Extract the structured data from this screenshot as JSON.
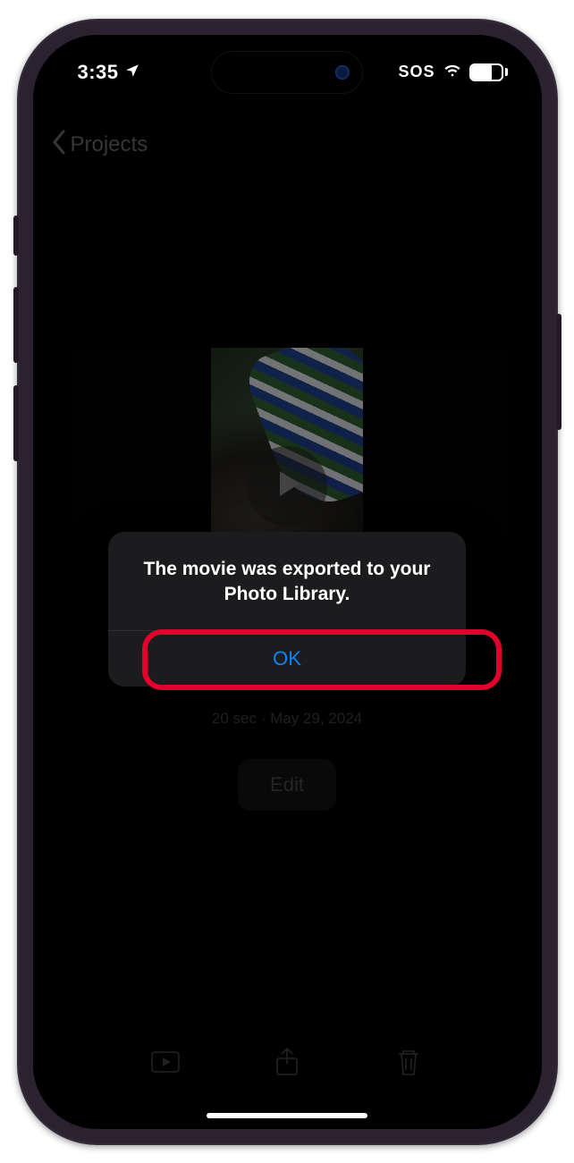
{
  "status_bar": {
    "time": "3:35",
    "sos": "SOS",
    "battery_percent": "70"
  },
  "nav": {
    "back_label": "Projects"
  },
  "project": {
    "meta": "20 sec · May 29, 2024",
    "edit_label": "Edit"
  },
  "alert": {
    "message": "The movie was exported to your Photo Library.",
    "ok_label": "OK"
  }
}
